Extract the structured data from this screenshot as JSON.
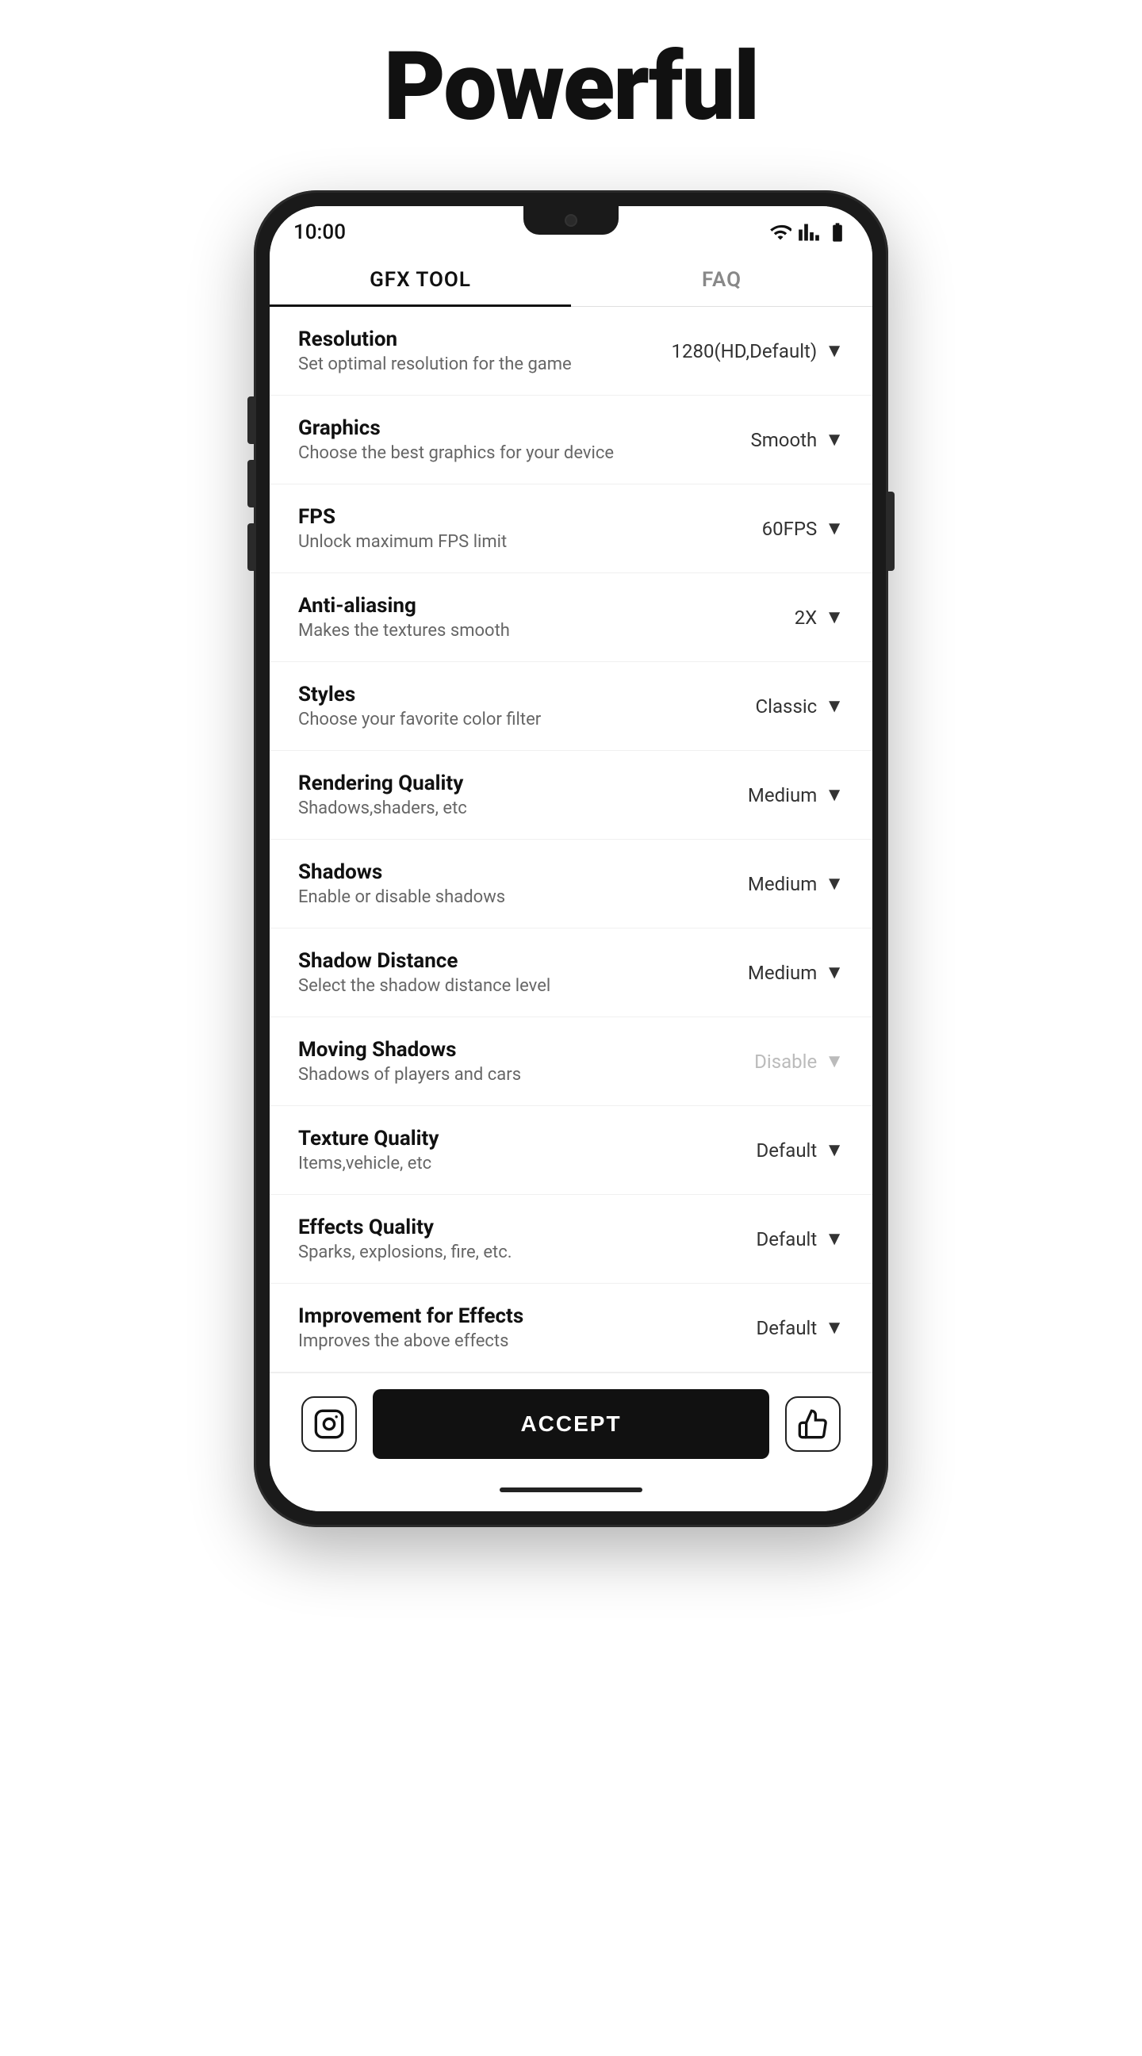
{
  "hero": {
    "title": "Powerful"
  },
  "status_bar": {
    "time": "10:00"
  },
  "tabs": [
    {
      "id": "gfx",
      "label": "GFX TOOL",
      "active": true
    },
    {
      "id": "faq",
      "label": "FAQ",
      "active": false
    }
  ],
  "settings": [
    {
      "id": "resolution",
      "title": "Resolution",
      "subtitle": "Set optimal resolution for the game",
      "value": "1280(HD,Default)",
      "disabled": false
    },
    {
      "id": "graphics",
      "title": "Graphics",
      "subtitle": "Choose the best graphics for your device",
      "value": "Smooth",
      "disabled": false
    },
    {
      "id": "fps",
      "title": "FPS",
      "subtitle": "Unlock maximum FPS limit",
      "value": "60FPS",
      "disabled": false
    },
    {
      "id": "anti-aliasing",
      "title": "Anti-aliasing",
      "subtitle": "Makes the textures smooth",
      "value": "2X",
      "disabled": false
    },
    {
      "id": "styles",
      "title": "Styles",
      "subtitle": "Choose your favorite color filter",
      "value": "Classic",
      "disabled": false
    },
    {
      "id": "rendering-quality",
      "title": "Rendering Quality",
      "subtitle": "Shadows,shaders, etc",
      "value": "Medium",
      "disabled": false
    },
    {
      "id": "shadows",
      "title": "Shadows",
      "subtitle": "Enable or disable shadows",
      "value": "Medium",
      "disabled": false
    },
    {
      "id": "shadow-distance",
      "title": "Shadow Distance",
      "subtitle": "Select the shadow distance level",
      "value": "Medium",
      "disabled": false
    },
    {
      "id": "moving-shadows",
      "title": "Moving Shadows",
      "subtitle": "Shadows of players and cars",
      "value": "Disable",
      "disabled": true
    },
    {
      "id": "texture-quality",
      "title": "Texture Quality",
      "subtitle": "Items,vehicle, etc",
      "value": "Default",
      "disabled": false
    },
    {
      "id": "effects-quality",
      "title": "Effects Quality",
      "subtitle": "Sparks, explosions, fire, etc.",
      "value": "Default",
      "disabled": false
    },
    {
      "id": "improvement-effects",
      "title": "Improvement for Effects",
      "subtitle": "Improves the above effects",
      "value": "Default",
      "disabled": false
    }
  ],
  "bottom_bar": {
    "accept_label": "ACCEPT",
    "instagram_icon": "instagram-icon",
    "thumbsup_icon": "thumbsup-icon"
  }
}
